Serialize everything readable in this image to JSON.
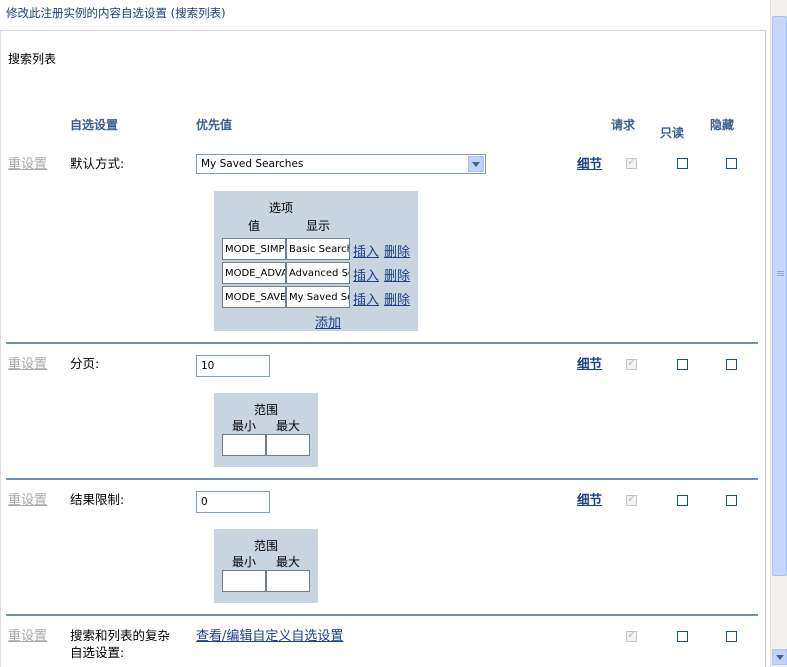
{
  "page_title": "修改此注册实例的内容自选设置 (搜索列表)",
  "section_title": "搜索列表",
  "headers": {
    "pref": "自选设置",
    "value": "优先值",
    "required": "请求",
    "readonly": "只读",
    "hidden": "隐藏"
  },
  "reset_label": "重设置",
  "detail_label": "细节",
  "rows": {
    "default_mode": {
      "label": "默认方式:",
      "selected": "My Saved Searches",
      "options_title": "选项",
      "col_value": "值",
      "col_display": "显示",
      "options": [
        {
          "value": "MODE_SIMP",
          "display": "Basic Search"
        },
        {
          "value": "MODE_ADVA",
          "display": "Advanced Se"
        },
        {
          "value": "MODE_SAVE",
          "display": "My Saved Se"
        }
      ],
      "insert_label": "插入",
      "delete_label": "删除",
      "add_label": "添加",
      "required": true,
      "readonly": false,
      "hidden": false
    },
    "paging": {
      "label": "分页:",
      "value": "10",
      "range_title": "范围",
      "min_label": "最小",
      "max_label": "最大",
      "min_value": "",
      "max_value": "",
      "required": true,
      "readonly": false,
      "hidden": false
    },
    "result_limit": {
      "label": "结果限制:",
      "value": "0",
      "range_title": "范围",
      "min_label": "最小",
      "max_label": "最大",
      "min_value": "",
      "max_value": "",
      "required": true,
      "readonly": false,
      "hidden": false
    },
    "complex": {
      "label_line1": "搜索和列表的复杂",
      "label_line2": "自选设置:",
      "link": "查看/编辑自定义自选设置",
      "required": true,
      "readonly": false,
      "hidden": false
    }
  },
  "colors": {
    "header_text": "#3a5f8f",
    "link": "#1c3e8c",
    "separator": "#6e8fb2",
    "option_box": "#c8d4df",
    "reset_disabled": "#a8a8a8"
  },
  "icons": [
    "dropdown-chevron-icon",
    "scroll-up-icon",
    "scroll-down-icon"
  ]
}
